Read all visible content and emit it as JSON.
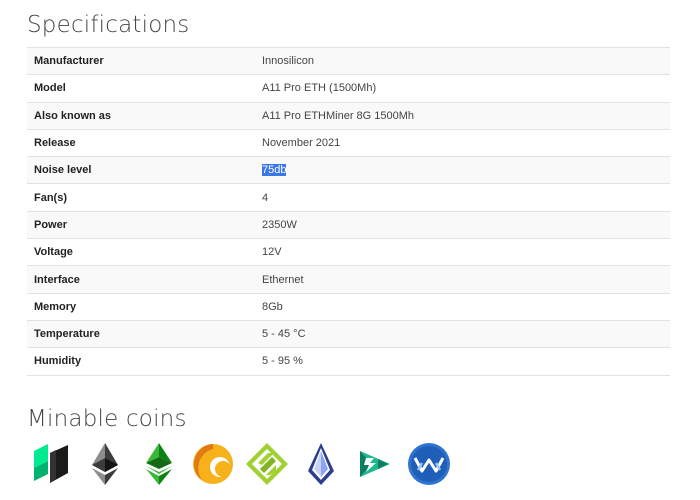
{
  "specifications": {
    "title": "Specifications",
    "rows": [
      {
        "label": "Manufacturer",
        "value": "Innosilicon"
      },
      {
        "label": "Model",
        "value": "A11 Pro ETH (1500Mh)"
      },
      {
        "label": "Also known as",
        "value": "A11 Pro ETHMiner 8G 1500Mh"
      },
      {
        "label": "Release",
        "value": "November 2021"
      },
      {
        "label": "Noise level",
        "value": "75db"
      },
      {
        "label": "Fan(s)",
        "value": "4"
      },
      {
        "label": "Power",
        "value": "2350W"
      },
      {
        "label": "Voltage",
        "value": "12V"
      },
      {
        "label": "Interface",
        "value": "Ethernet"
      },
      {
        "label": "Memory",
        "value": "8Gb"
      },
      {
        "label": "Temperature",
        "value": "5 - 45 °C"
      },
      {
        "label": "Humidity",
        "value": "5 - 95 %"
      }
    ],
    "selection_color": "#3b78e7"
  },
  "minable_coins": {
    "title": "Minable coins",
    "coins": [
      {
        "icon": "ubiq-coin-icon",
        "color": "#00ea90"
      },
      {
        "icon": "ethereum-coin-icon",
        "color": "#3c3c3d"
      },
      {
        "icon": "ethereum-classic-coin-icon",
        "color": "#3ab83a"
      },
      {
        "icon": "callisto-coin-icon",
        "color": "#f7b21b"
      },
      {
        "icon": "expanse-coin-icon",
        "color": "#a0d131"
      },
      {
        "icon": "pirl-coin-icon",
        "color": "#5b6ee1"
      },
      {
        "icon": "ellaism-coin-icon",
        "color": "#1db88e"
      },
      {
        "icon": "metaverse-coin-icon",
        "color": "#2f74d0"
      }
    ]
  }
}
